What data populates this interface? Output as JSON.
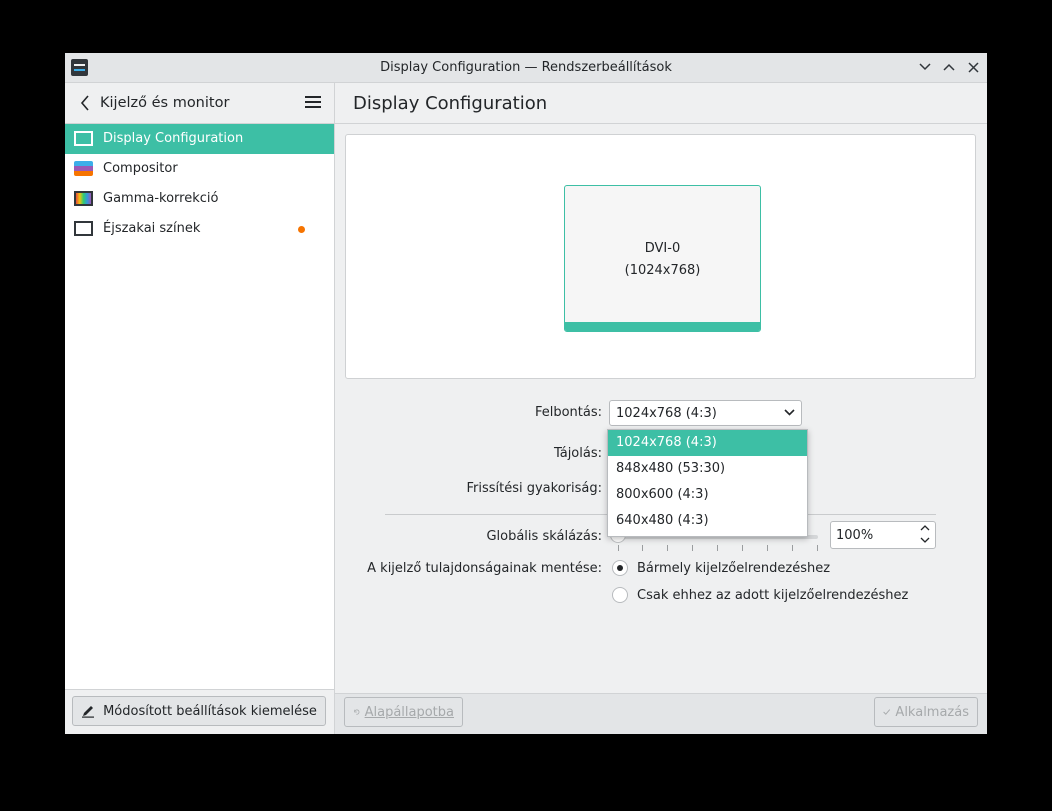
{
  "window": {
    "title": "Display Configuration — Rendszerbeállítások",
    "buttons": [
      "minimize",
      "maximize",
      "close"
    ]
  },
  "sidebar": {
    "title": "Kijelző és monitor",
    "items": [
      {
        "label": "Display Configuration",
        "icon": "monitor-icon",
        "active": true
      },
      {
        "label": "Compositor",
        "icon": "compositor-icon",
        "active": false
      },
      {
        "label": "Gamma-korrekció",
        "icon": "gamma-icon",
        "active": false
      },
      {
        "label": "Éjszakai színek",
        "icon": "monitor-icon",
        "active": false,
        "badge": "orange-dot"
      }
    ],
    "footer_button": "Módosított beállítások kiemelése"
  },
  "main": {
    "title": "Display Configuration",
    "output": {
      "name": "DVI-0",
      "resolution": "(1024x768)"
    },
    "labels": {
      "resolution": "Felbontás:",
      "orientation": "Tájolás:",
      "refresh": "Frissítési gyakoriság:",
      "scale": "Globális skálázás:",
      "save": "A kijelző tulajdonságainak mentése:"
    },
    "resolution_value": "1024x768 (4:3)",
    "resolution_options": [
      "1024x768 (4:3)",
      "848x480 (53:30)",
      "800x600 (4:3)",
      "640x480 (4:3)"
    ],
    "scale_value": "100%",
    "save_options": [
      {
        "label": "Bármely kijelzőelrendezéshez",
        "checked": true
      },
      {
        "label": "Csak ehhez az adott kijelzőelrendezéshez",
        "checked": false
      }
    ],
    "buttons": {
      "reset": "Alapállapotba",
      "apply": "Alkalmazás"
    }
  },
  "colors": {
    "accent": "#3dbfa5",
    "badge": "#f67400"
  }
}
